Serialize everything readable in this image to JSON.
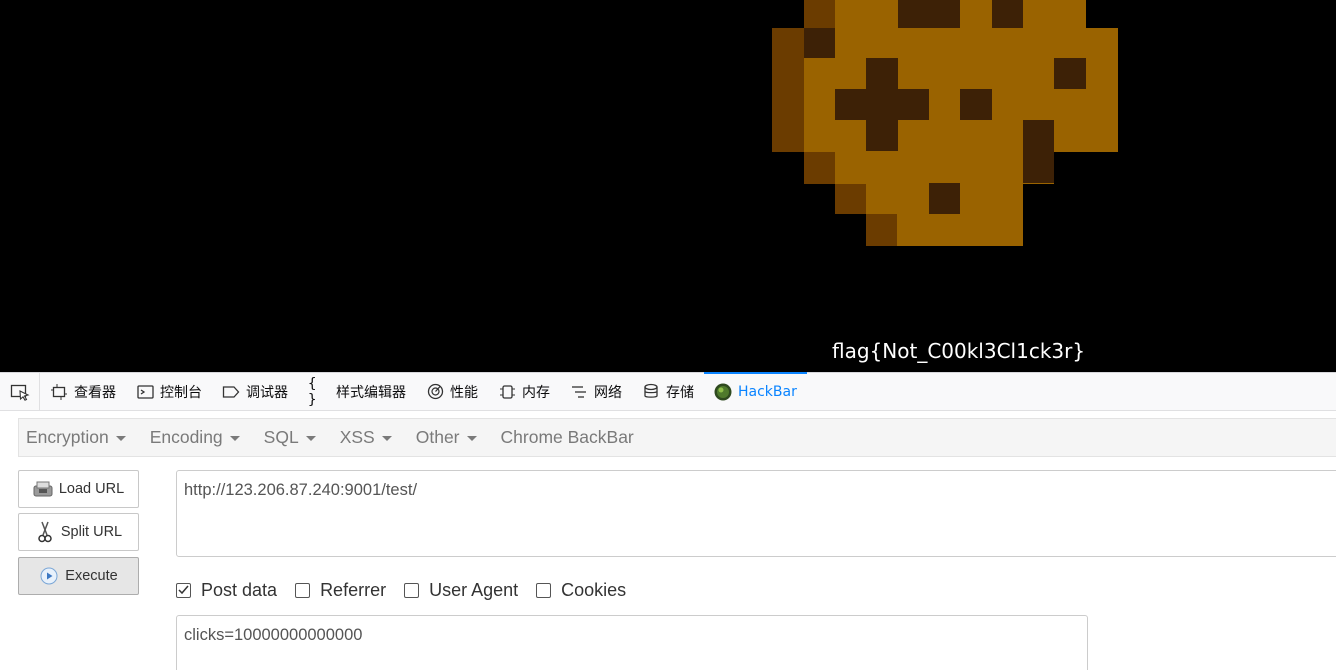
{
  "page": {
    "flag_text": "flag{Not_C00kl3Cl1ck3r}"
  },
  "devtools": {
    "tabs": [
      {
        "label": "查看器",
        "icon": "inspector-icon"
      },
      {
        "label": "控制台",
        "icon": "console-icon"
      },
      {
        "label": "调试器",
        "icon": "debugger-icon"
      },
      {
        "label": "样式编辑器",
        "icon": "style-editor-icon"
      },
      {
        "label": "性能",
        "icon": "performance-icon"
      },
      {
        "label": "内存",
        "icon": "memory-icon"
      },
      {
        "label": "网络",
        "icon": "network-icon"
      },
      {
        "label": "存储",
        "icon": "storage-icon"
      },
      {
        "label": "HackBar",
        "icon": "hackbar-icon",
        "active": true
      }
    ],
    "active_color": "#0a84ff"
  },
  "hackbar": {
    "menus": [
      "Encryption",
      "Encoding",
      "SQL",
      "XSS",
      "Other",
      "Chrome BackBar"
    ],
    "buttons": {
      "load_url": "Load URL",
      "split_url": "Split URL",
      "execute": "Execute"
    },
    "url_value": "http://123.206.87.240:9001/test/",
    "options": {
      "post_data": {
        "label": "Post data",
        "checked": true
      },
      "referrer": {
        "label": "Referrer",
        "checked": false
      },
      "user_agent": {
        "label": "User Agent",
        "checked": false
      },
      "cookies": {
        "label": "Cookies",
        "checked": false
      }
    },
    "post_value": "clicks=10000000000000"
  }
}
